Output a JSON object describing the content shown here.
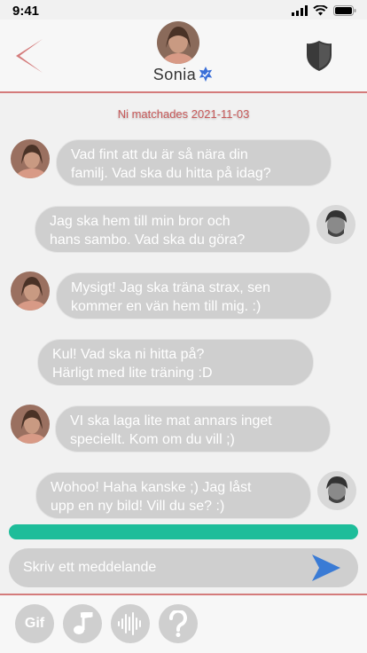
{
  "status_bar": {
    "time": "9:41"
  },
  "header": {
    "contact_name": "Sonia"
  },
  "conversation": {
    "match_text": "Ni matchades 2021-11-03",
    "messages": [
      {
        "from": "them",
        "text": "Vad fint att du är så nära din\nfamilj. Vad ska du hitta på idag?"
      },
      {
        "from": "me",
        "text": "Jag ska hem till min bror och\nhans sambo. Vad ska du göra?"
      },
      {
        "from": "them",
        "text": "Mysigt! Jag ska träna strax, sen\nkommer en vän hem till mig. :)"
      },
      {
        "from": "them",
        "text": "Kul! Vad ska ni hitta på?\nHärligt med lite träning :D"
      },
      {
        "from": "them",
        "text": "VI ska laga lite mat annars inget\nspeciellt. Kom om du vill ;)"
      },
      {
        "from": "me",
        "text": "Wohoo! Haha kanske ;) Jag låst\nupp en ny bild! Vill du se? :)"
      }
    ]
  },
  "composer": {
    "placeholder": "Skriv ett meddelande"
  },
  "progress": {
    "value": 1.0,
    "color": "#1ebd9a"
  },
  "toolbar": {
    "gif_label": "Gif"
  },
  "colors": {
    "accent": "#d47b7b",
    "bubble": "#cfcfcf",
    "send": "#3a7bd5",
    "verified": "#3a6fd8"
  },
  "icons": [
    "back-chevron-icon",
    "shield-icon",
    "verified-badge-icon",
    "send-icon",
    "music-note-icon",
    "audio-wave-icon",
    "help-icon"
  ]
}
